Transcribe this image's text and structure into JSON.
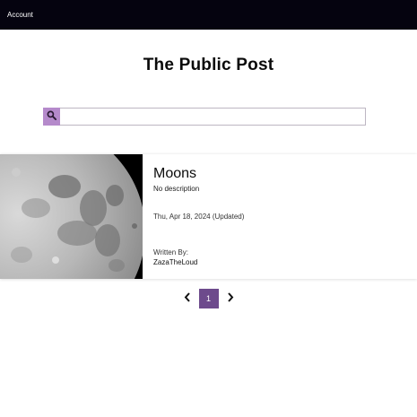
{
  "nav": {
    "account_label": "Account"
  },
  "header": {
    "title": "The Public Post"
  },
  "search": {
    "placeholder": "",
    "value": ""
  },
  "posts": [
    {
      "title": "Moons",
      "description": "No description",
      "date": "Thu, Apr 18, 2024 (Updated)",
      "written_by_label": "Written By:",
      "author": "ZazaTheLoud",
      "thumbnail": "moon-image"
    }
  ],
  "pagination": {
    "current_page": "1"
  },
  "colors": {
    "topbar": "#05030f",
    "search_button": "#b58acb",
    "active_page": "#6d4a8c"
  },
  "icons": {
    "search": "search-icon",
    "prev": "chevron-left-icon",
    "next": "chevron-right-icon"
  }
}
